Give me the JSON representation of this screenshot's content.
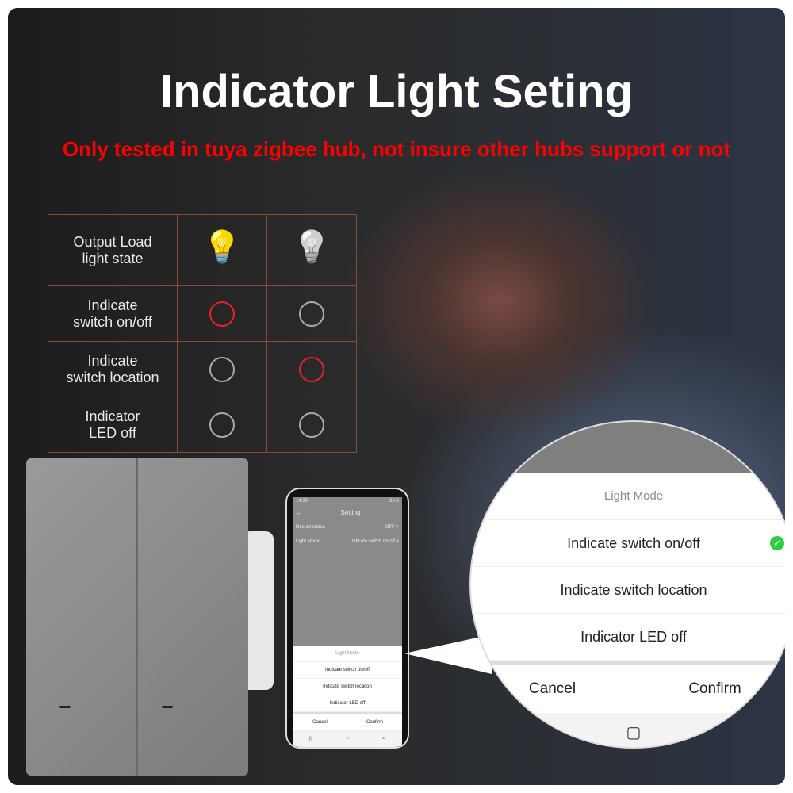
{
  "title": "Indicator Light Seting",
  "subtitle": "Only tested in tuya zigbee hub, not insure other hubs support or not",
  "table": {
    "header": [
      "Output Load",
      "light state"
    ],
    "rows": [
      {
        "label": [
          "Indicate",
          "switch on/off"
        ],
        "on": true,
        "off": false
      },
      {
        "label": [
          "Indicate",
          "switch location"
        ],
        "on": false,
        "off": true
      },
      {
        "label": [
          "Indicator",
          "LED off"
        ],
        "on": false,
        "off": false
      }
    ]
  },
  "phone": {
    "time": "14:30",
    "status": "31%",
    "header": "Setting",
    "back": "←",
    "rows": [
      {
        "label": "Restart status",
        "value": "OFF >"
      },
      {
        "label": "Light Mode",
        "value": "Indicate switch on/off >"
      }
    ],
    "sheet_title": "Light Mode",
    "options": [
      "Indicate switch on/off",
      "Indicate switch location",
      "Indicator LED off"
    ],
    "cancel": "Cancel",
    "confirm": "Confirm",
    "nav": [
      "|||",
      "○",
      "<"
    ]
  },
  "magnifier": {
    "title": "Light Mode",
    "options": [
      "Indicate switch on/off",
      "Indicate switch location",
      "Indicator LED off"
    ],
    "selected": 0,
    "cancel": "Cancel",
    "confirm": "Confirm",
    "home": "▢"
  },
  "colors": {
    "accent_red": "#ff0000",
    "ring_on": "#e8202a",
    "check": "#2ecc40"
  }
}
